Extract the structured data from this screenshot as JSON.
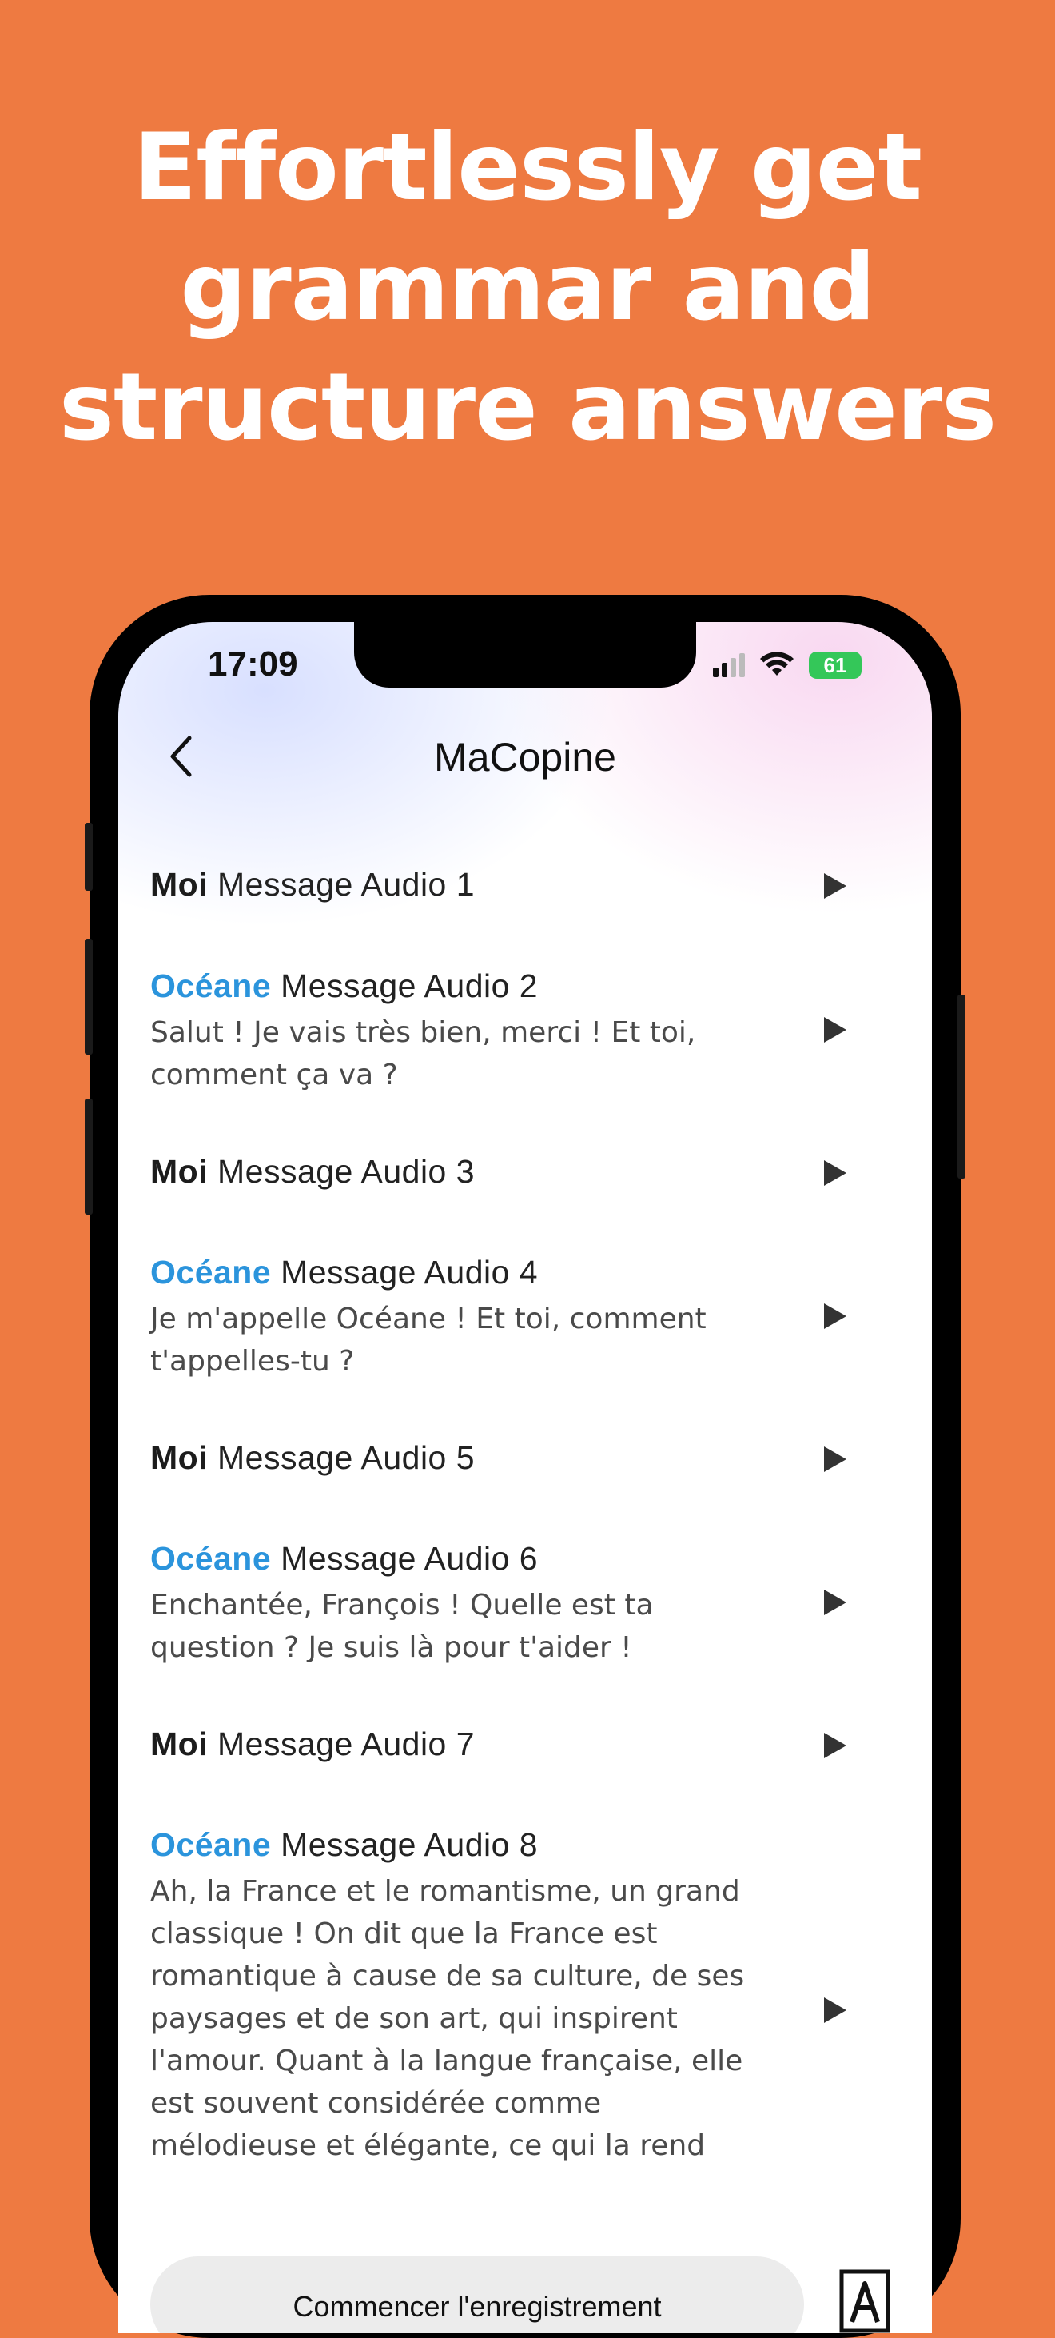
{
  "headline": {
    "line1": "Effortlessly get",
    "line2": "grammar and",
    "line3": "structure answers"
  },
  "status_bar": {
    "time": "17:09",
    "battery": "61",
    "icons": [
      "signal-icon",
      "wifi-icon",
      "battery-charging-icon"
    ]
  },
  "nav": {
    "title": "MaCopine",
    "back_icon": "chevron-left-icon"
  },
  "messages": [
    {
      "sender": "Moi",
      "label": "Message Audio 1",
      "text": ""
    },
    {
      "sender": "Océane",
      "label": "Message Audio 2",
      "text": "Salut ! Je vais très bien, merci ! Et toi, comment ça va ?"
    },
    {
      "sender": "Moi",
      "label": "Message Audio 3",
      "text": ""
    },
    {
      "sender": "Océane",
      "label": "Message Audio 4",
      "text": "Je m'appelle Océane ! Et toi, comment t'appelles-tu ?"
    },
    {
      "sender": "Moi",
      "label": "Message Audio 5",
      "text": ""
    },
    {
      "sender": "Océane",
      "label": "Message Audio 6",
      "text": "Enchantée, François ! Quelle est ta question ? Je suis là pour t'aider !"
    },
    {
      "sender": "Moi",
      "label": "Message Audio 7",
      "text": ""
    },
    {
      "sender": "Océane",
      "label": "Message Audio 8",
      "text": "Ah, la France et le romantisme, un grand classique ! On dit que la France est romantique à cause de sa culture, de ses paysages et de son art, qui inspirent l'amour. Quant à la langue française, elle est souvent considérée comme mélodieuse et élégante, ce qui la rend"
    }
  ],
  "bottom": {
    "record_label": "Commencer l'enregistrement",
    "font_icon": "font-size-icon"
  },
  "colors": {
    "background": "#EE7A41",
    "accent": "#2B94DC"
  }
}
